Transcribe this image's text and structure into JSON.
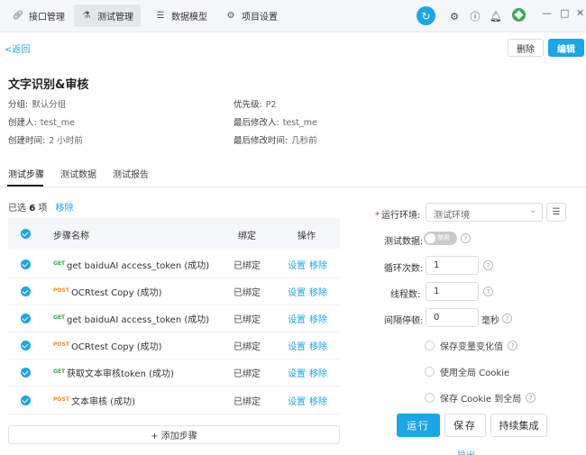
{
  "nav": {
    "tabs": [
      {
        "label": "接口管理",
        "icon": "link-icon"
      },
      {
        "label": "测试管理",
        "icon": "flask-icon"
      },
      {
        "label": "数据模型",
        "icon": "model-icon"
      },
      {
        "label": "项目设置",
        "icon": "gear-icon"
      }
    ],
    "active_tab": "测试管理"
  },
  "header": {
    "back_label": "<返回",
    "delete_label": "删除",
    "edit_label": "编辑"
  },
  "case": {
    "title": "文字识别&审核",
    "group_label": "分组:",
    "group_value": "默认分组",
    "priority_label": "优先级:",
    "priority_value": "P2",
    "creator_label": "创建人:",
    "creator_value": "test_me",
    "modifier_label": "最后修改人:",
    "modifier_value": "test_me",
    "created_label": "创建时间:",
    "created_value": "2 小时前",
    "modified_label": "最后修改时间:",
    "modified_value": "几秒前"
  },
  "subtabs": [
    "测试步骤",
    "测试数据",
    "测试报告"
  ],
  "selection": {
    "prefix": "已选",
    "count": "6",
    "suffix": "项",
    "remove_label": "移除"
  },
  "table": {
    "headers": {
      "name": "步骤名称",
      "bind": "绑定",
      "ops": "操作"
    },
    "rows": [
      {
        "method": "GET",
        "name": "get baiduAI access_token (成功)",
        "bind": "已绑定",
        "op1": "设置",
        "op2": "移除"
      },
      {
        "method": "POST",
        "name": "OCRtest Copy (成功)",
        "bind": "已绑定",
        "op1": "设置",
        "op2": "移除"
      },
      {
        "method": "GET",
        "name": "get baiduAI access_token (成功)",
        "bind": "已绑定",
        "op1": "设置",
        "op2": "移除"
      },
      {
        "method": "POST",
        "name": "OCRtest Copy (成功)",
        "bind": "已绑定",
        "op1": "设置",
        "op2": "移除"
      },
      {
        "method": "GET",
        "name": "获取文本审核token (成功)",
        "bind": "已绑定",
        "op1": "设置",
        "op2": "移除"
      },
      {
        "method": "POST",
        "name": "文本审核 (成功)",
        "bind": "已绑定",
        "op1": "设置",
        "op2": "移除"
      }
    ],
    "add_step_label": "+ 添加步骤"
  },
  "run_panel": {
    "env_label": "运行环境:",
    "env_value": "测试环境",
    "data_label": "测试数据:",
    "data_toggle_text": "禁用",
    "loop_label": "循环次数:",
    "loop_value": "1",
    "threads_label": "线程数:",
    "threads_value": "1",
    "interval_label": "间隔停顿:",
    "interval_value": "0",
    "interval_unit": "毫秒",
    "opt_save_var": "保存变量变化值",
    "opt_global_cookie": "使用全局 Cookie",
    "opt_save_cookie": "保存 Cookie 到全局",
    "run_label": "运行",
    "save_label": "保存",
    "ci_label": "持续集成",
    "export_label": "导出 ⌄"
  }
}
